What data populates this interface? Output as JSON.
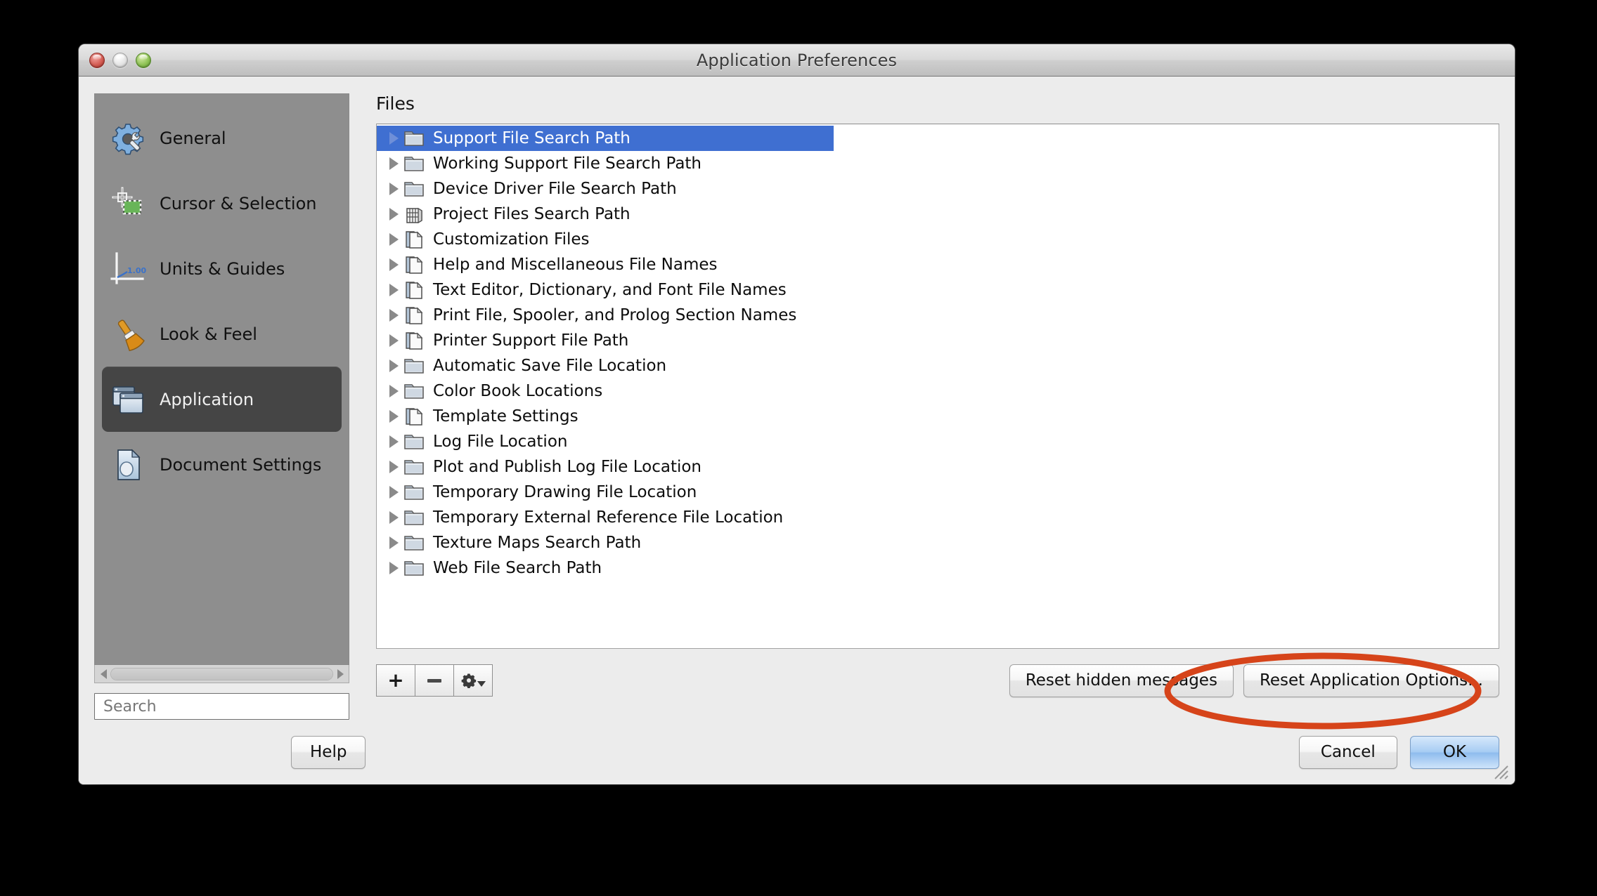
{
  "window": {
    "title": "Application Preferences",
    "controls": {
      "close": "close-button",
      "minimize": "minimize-button",
      "maximize": "maximize-button"
    }
  },
  "sidebar": {
    "items": [
      {
        "label": "General",
        "icon": "gear-wrench-icon",
        "selected": false
      },
      {
        "label": "Cursor & Selection",
        "icon": "crosshair-selection-icon",
        "selected": false
      },
      {
        "label": "Units & Guides",
        "icon": "ruler-axis-icon",
        "selected": false
      },
      {
        "label": "Look & Feel",
        "icon": "paintbrush-icon",
        "selected": false
      },
      {
        "label": "Application",
        "icon": "windows-stack-icon",
        "selected": true
      },
      {
        "label": "Document Settings",
        "icon": "document-icon",
        "selected": false
      }
    ],
    "scrollbar": {
      "left_arrow": "scroll-left-arrow",
      "right_arrow": "scroll-right-arrow"
    },
    "search": {
      "placeholder": "Search",
      "value": ""
    }
  },
  "main": {
    "section_label": "Files",
    "tree": [
      {
        "label": "Support File Search Path",
        "icon": "folder-icon",
        "selected": true,
        "expandable": true
      },
      {
        "label": "Working Support File Search Path",
        "icon": "folder-icon",
        "selected": false,
        "expandable": true
      },
      {
        "label": "Device Driver File Search Path",
        "icon": "folder-icon",
        "selected": false,
        "expandable": true
      },
      {
        "label": "Project Files Search Path",
        "icon": "project-icon",
        "selected": false,
        "expandable": true
      },
      {
        "label": "Customization Files",
        "icon": "document-icon",
        "selected": false,
        "expandable": true
      },
      {
        "label": "Help and Miscellaneous File Names",
        "icon": "document-icon",
        "selected": false,
        "expandable": true
      },
      {
        "label": "Text Editor, Dictionary, and Font File Names",
        "icon": "document-icon",
        "selected": false,
        "expandable": true
      },
      {
        "label": "Print File, Spooler, and Prolog Section Names",
        "icon": "document-icon",
        "selected": false,
        "expandable": true
      },
      {
        "label": "Printer Support File Path",
        "icon": "document-icon",
        "selected": false,
        "expandable": true
      },
      {
        "label": "Automatic Save File Location",
        "icon": "folder-icon",
        "selected": false,
        "expandable": true
      },
      {
        "label": "Color Book Locations",
        "icon": "folder-icon",
        "selected": false,
        "expandable": true
      },
      {
        "label": "Template Settings",
        "icon": "document-icon",
        "selected": false,
        "expandable": true
      },
      {
        "label": "Log File Location",
        "icon": "folder-icon",
        "selected": false,
        "expandable": true
      },
      {
        "label": "Plot and Publish Log File Location",
        "icon": "folder-icon",
        "selected": false,
        "expandable": true
      },
      {
        "label": "Temporary Drawing File Location",
        "icon": "folder-icon",
        "selected": false,
        "expandable": true
      },
      {
        "label": "Temporary External Reference File Location",
        "icon": "folder-icon",
        "selected": false,
        "expandable": true
      },
      {
        "label": "Texture Maps Search Path",
        "icon": "folder-icon",
        "selected": false,
        "expandable": true
      },
      {
        "label": "Web File Search Path",
        "icon": "folder-icon",
        "selected": false,
        "expandable": true
      }
    ],
    "toolbar": {
      "add": "+",
      "remove": "−",
      "options_icon": "gear-icon",
      "reset_hidden_messages": "Reset hidden messages",
      "reset_application_options": "Reset Application Options..."
    }
  },
  "footer": {
    "help": "Help",
    "cancel": "Cancel",
    "ok": "OK"
  },
  "annotation": {
    "shape": "ellipse",
    "color": "#d6441a",
    "target": "Reset Application Options..."
  },
  "colors": {
    "selection_blue": "#3f6fd1",
    "sidebar_bg": "#8e8e8e",
    "sidebar_selected": "#454545",
    "window_bg": "#ececec",
    "annotation": "#d6441a",
    "default_button_blue": "#a8cdf3"
  }
}
